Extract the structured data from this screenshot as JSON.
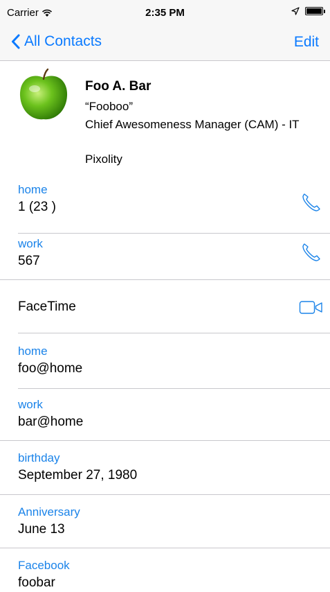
{
  "status_bar": {
    "carrier": "Carrier",
    "time": "2:35 PM",
    "icons": [
      "wifi-icon",
      "location-arrow-icon",
      "battery-icon"
    ]
  },
  "nav": {
    "back_label": "All Contacts",
    "edit_label": "Edit",
    "accent_color": "#0a7aff"
  },
  "contact": {
    "name": "Foo A. Bar",
    "nickname": "“Fooboo”",
    "job_title": "Chief Awesomeness Manager (CAM) - IT",
    "company": "Pixolity",
    "photo": "green-apple-image"
  },
  "phones": [
    {
      "label": "home",
      "value": "1 (23 )"
    },
    {
      "label": "work",
      "value": "567"
    }
  ],
  "facetime_label": "FaceTime",
  "emails": [
    {
      "label": "home",
      "value": "foo@home"
    },
    {
      "label": "work",
      "value": "bar@home"
    }
  ],
  "birthday": {
    "label": "birthday",
    "value": "September 27, 1980"
  },
  "anniversary": {
    "label": "Anniversary",
    "value": "June 13"
  },
  "facebook": {
    "label": "Facebook",
    "value": "foobar"
  }
}
